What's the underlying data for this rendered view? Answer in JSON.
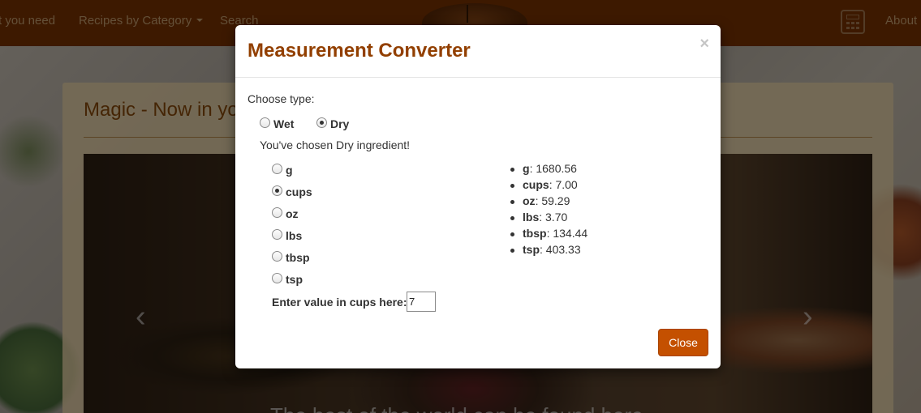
{
  "navbar": {
    "items": [
      "t you need",
      "Recipes by Category",
      "Search",
      "About U"
    ]
  },
  "page": {
    "panel_title": "Magic - Now in yo",
    "carousel_prev": "‹",
    "carousel_next": "›",
    "carousel_caption": "The best of the world can be found here"
  },
  "modal": {
    "title": "Measurement Converter",
    "close_x": "×",
    "choose_type_label": "Choose type:",
    "type_options": [
      {
        "label": "Wet",
        "checked": false
      },
      {
        "label": "Dry",
        "checked": true
      }
    ],
    "chosen_message": "You've chosen Dry ingredient!",
    "unit_options": [
      {
        "label": "g",
        "checked": false
      },
      {
        "label": "cups",
        "checked": true
      },
      {
        "label": "oz",
        "checked": false
      },
      {
        "label": "lbs",
        "checked": false
      },
      {
        "label": "tbsp",
        "checked": false
      },
      {
        "label": "tsp",
        "checked": false
      }
    ],
    "results": [
      {
        "unit": "g",
        "value": ": 1680.56"
      },
      {
        "unit": "cups",
        "value": ": 7.00"
      },
      {
        "unit": "oz",
        "value": ": 59.29"
      },
      {
        "unit": "lbs",
        "value": ": 3.70"
      },
      {
        "unit": "tbsp",
        "value": ": 134.44"
      },
      {
        "unit": "tsp",
        "value": ": 403.33"
      }
    ],
    "input_label": "Enter value in cups here:",
    "input_value": "7",
    "close_button": "Close"
  },
  "colors": {
    "navbar": "#7a3300",
    "modal_title": "#923f00",
    "close_button": "#c45000"
  },
  "icons": {
    "calculator": "calculator-icon",
    "dialog_close": "close-icon"
  }
}
